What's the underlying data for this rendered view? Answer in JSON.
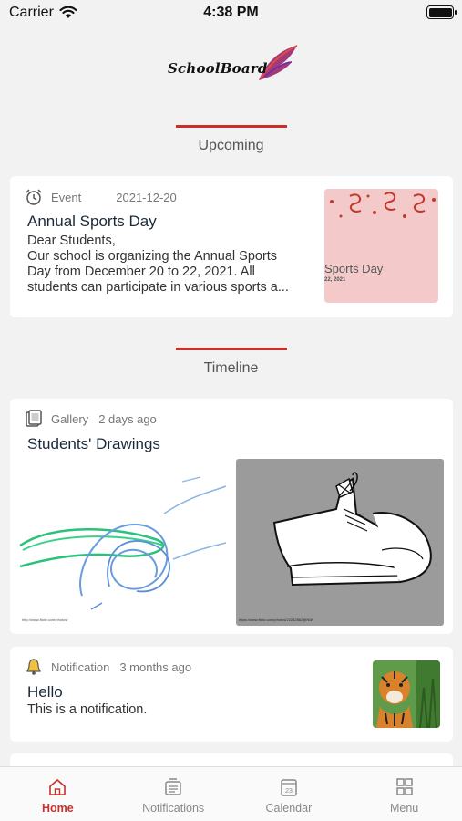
{
  "status_bar": {
    "carrier": "Carrier",
    "time": "4:38 PM"
  },
  "logo_text": "SchoolBoard",
  "sections": {
    "upcoming": "Upcoming",
    "timeline": "Timeline"
  },
  "event_card": {
    "type": "Event",
    "date": "2021-12-20",
    "title": "Annual Sports Day",
    "body_line1": "Dear Students,",
    "body_line2": "Our school is organizing the Annual Sports",
    "body_line3": "Day from December 20 to 22, 2021. All",
    "body_line4": "students can participate in various sports a...",
    "thumb_text": "Sports Day",
    "thumb_subtext": "22, 2021"
  },
  "gallery_card": {
    "type": "Gallery",
    "date": "2 days ago",
    "title": "Students' Drawings",
    "image1_caption": "http://www.flickr.com/photos/",
    "image2_caption": "https://www.flickr.com/photos/22282862@N08"
  },
  "notification_card": {
    "type": "Notification",
    "date": "3 months ago",
    "title": "Hello",
    "body": "This is a notification."
  },
  "tabs": [
    {
      "label": "Home",
      "icon": "home-icon",
      "active": true
    },
    {
      "label": "Notifications",
      "icon": "notifications-icon",
      "active": false
    },
    {
      "label": "Calendar",
      "icon": "calendar-icon",
      "active": false,
      "day": "23"
    },
    {
      "label": "Menu",
      "icon": "menu-grid-icon",
      "active": false
    }
  ],
  "colors": {
    "accent": "#c9302c",
    "background": "#f2f2f2",
    "card": "#ffffff"
  }
}
